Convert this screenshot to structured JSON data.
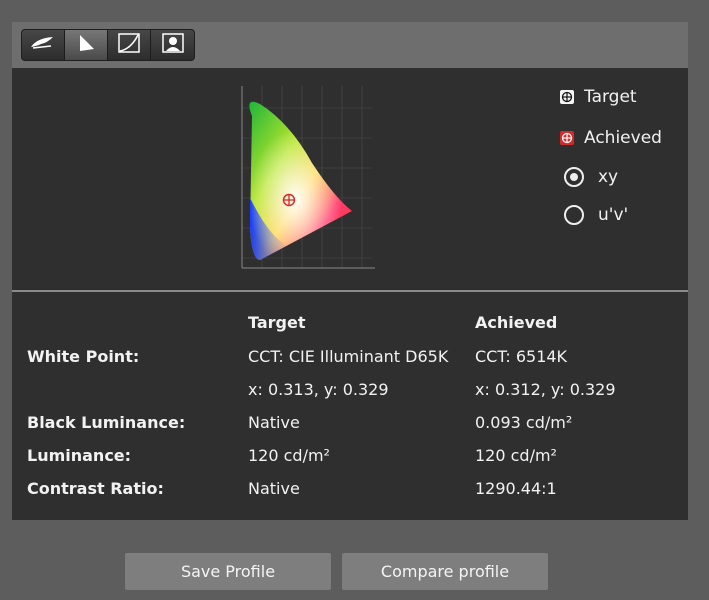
{
  "toolbar": {
    "tools": [
      {
        "icon": "gamut-curve-icon"
      },
      {
        "icon": "triangle-gamut-icon"
      },
      {
        "icon": "tone-curve-icon"
      },
      {
        "icon": "profile-image-icon"
      }
    ]
  },
  "legend": {
    "target_label": "Target",
    "achieved_label": "Achieved",
    "xy_label": "xy",
    "uv_label": "u'v'",
    "selected": "xy"
  },
  "table": {
    "target_header": "Target",
    "achieved_header": "Achieved",
    "rows": [
      {
        "label": "White Point:",
        "target": "CCT: CIE Illuminant D65K",
        "achieved": "CCT: 6514K"
      },
      {
        "label": "",
        "target": "x: 0.313, y: 0.329",
        "achieved": "x: 0.312, y: 0.329"
      },
      {
        "label": "Black Luminance:",
        "target": "Native",
        "achieved": "0.093 cd/m²"
      },
      {
        "label": "Luminance:",
        "target": "120 cd/m²",
        "achieved": "120 cd/m²"
      },
      {
        "label": "Contrast Ratio:",
        "target": "Native",
        "achieved": "1290.44:1"
      }
    ]
  },
  "buttons": {
    "save": "Save Profile",
    "compare": "Compare profile"
  },
  "colors": {
    "target_marker": "#f4f4f4",
    "achieved_marker": "#d42a2a",
    "panel_background": "#2f2f2f"
  }
}
